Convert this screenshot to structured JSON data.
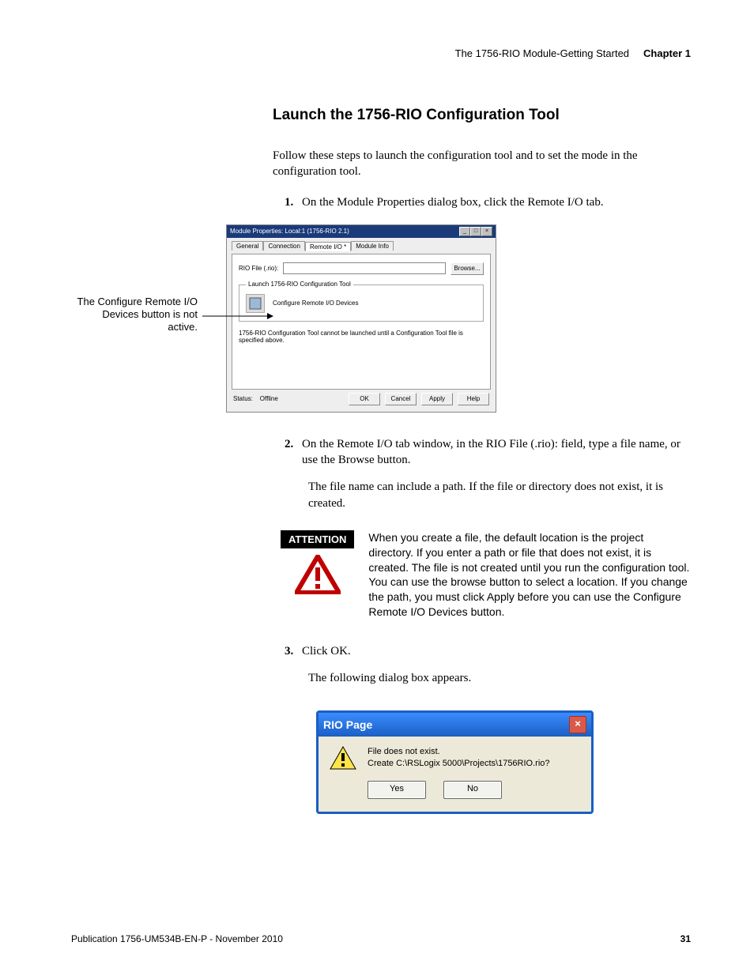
{
  "header": {
    "breadcrumb": "The 1756-RIO Module-Getting Started",
    "chapter": "Chapter 1"
  },
  "section_title": "Launch the 1756-RIO Configuration Tool",
  "intro": "Follow these steps to launch the configuration tool and to set the mode in the configuration tool.",
  "steps": {
    "1": "On the Module Properties dialog box, click the Remote I/O tab.",
    "2": "On the Remote I/O tab window, in the RIO File (.rio): field, type a file name, or use the Browse button.",
    "2_sub": "The file name can include a path. If the file or directory does not exist, it is created.",
    "3": "Click OK.",
    "3_sub": "The following dialog box appears."
  },
  "callout": "The Configure Remote I/O Devices button is not active.",
  "mod_dialog": {
    "title": "Module Properties: Local:1 (1756-RIO 2.1)",
    "tabs": [
      "General",
      "Connection",
      "Remote I/O *",
      "Module Info"
    ],
    "rio_file_label": "RIO File (.rio):",
    "browse": "Browse...",
    "fieldset_title": "Launch 1756-RIO Configuration Tool",
    "config_btn": "Configure Remote I/O Devices",
    "warn": "1756-RIO Configuration Tool cannot be launched until a Configuration Tool file is specified above.",
    "status_label": "Status:",
    "status_value": "Offline",
    "buttons": {
      "ok": "OK",
      "cancel": "Cancel",
      "apply": "Apply",
      "help": "Help"
    }
  },
  "attention": {
    "label": "ATTENTION",
    "text": "When you create a file, the default location is the project directory. If you enter a path or file that does not exist, it is created. The file is not created until you run the configuration tool. You can use the browse button to select a location. If you change the path, you must click Apply before you can use the Configure Remote I/O Devices button."
  },
  "rio_page": {
    "title": "RIO Page",
    "line1": "File does not exist.",
    "line2": "Create C:\\RSLogix 5000\\Projects\\1756RIO.rio?",
    "yes": "Yes",
    "no": "No"
  },
  "footer": {
    "pub": "Publication 1756-UM534B-EN-P - November 2010",
    "page": "31"
  }
}
